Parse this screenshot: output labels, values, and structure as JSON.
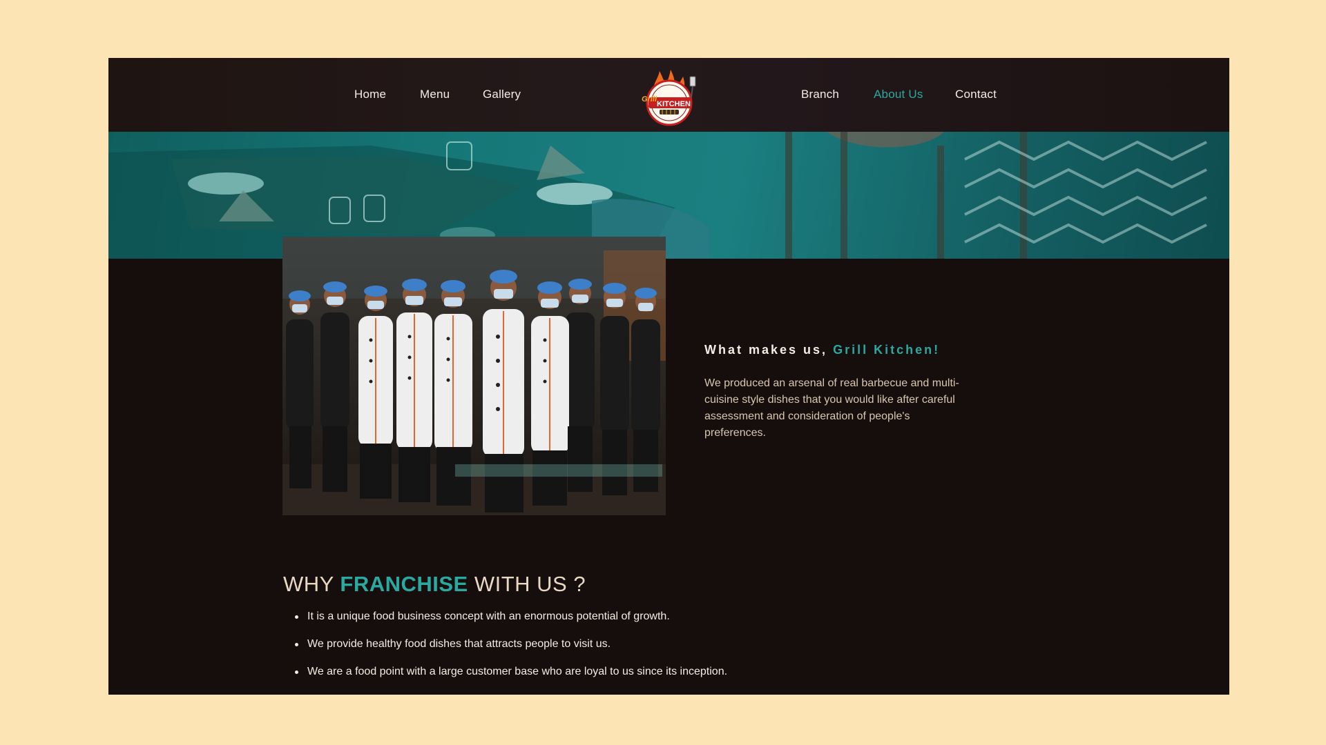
{
  "nav": {
    "items_left": [
      {
        "label": "Home"
      },
      {
        "label": "Menu"
      },
      {
        "label": "Gallery"
      }
    ],
    "items_right": [
      {
        "label": "Branch"
      },
      {
        "label": "About Us",
        "active": true
      },
      {
        "label": "Contact"
      }
    ],
    "logo": {
      "text_top": "Grill",
      "text_main": "KITCHEN",
      "icon": "flame-grill-logo"
    }
  },
  "about": {
    "heading_prefix": "What makes us,",
    "heading_accent": "Grill Kitchen!",
    "body": "We produced an arsenal of real barbecue and multi-cuisine style dishes that you would like after careful assessment and consideration of people's preferences."
  },
  "franchise": {
    "heading_pre": "WHY",
    "heading_accent": "FRANCHISE",
    "heading_post": "WITH US ?",
    "points": [
      "It is a unique food business concept with an enormous potential of growth.",
      "We provide healthy food dishes that attracts people to visit us.",
      "We are a food point with a large customer base who are loyal to us since its inception."
    ]
  },
  "colors": {
    "accent": "#2aa9a0",
    "page_background": "#fce4b4",
    "frame_background": "#160e0c"
  }
}
